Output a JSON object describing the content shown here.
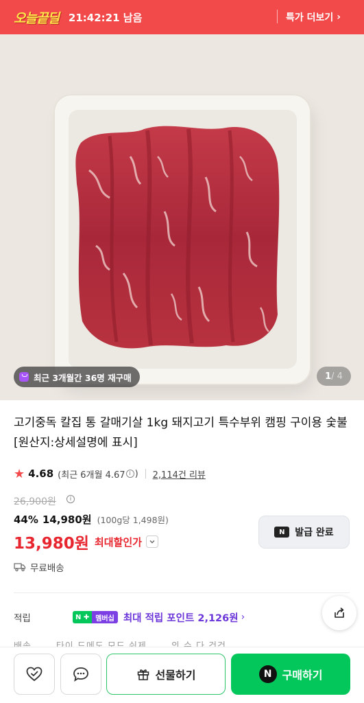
{
  "deal": {
    "logo": "오늘끝딜",
    "timer": "21:42:21 남음",
    "more_label": "특가 더보기",
    "more_chevron": "›"
  },
  "hero": {
    "repurchase_text": "최근 3개월간 36명 재구매",
    "counter_current": "1",
    "counter_total": "/ 4"
  },
  "product": {
    "title": "고기중독 칼집 통 갈매기살 1kg 돼지고기 특수부위 캠핑 구이용 숯불 [원산지:상세설명에 표시]",
    "rating": "4.68",
    "rating_recent_prefix": "(최근 6개월 4.67",
    "rating_recent_suffix": ")",
    "review_link": "2,114건 리뷰",
    "original_price": "26,900원",
    "discount_pct": "44%",
    "discount_price": "14,980원",
    "unit_price": "(100g당 1,498원)",
    "final_price": "13,980원",
    "final_label": "최대할인가",
    "coupon_label": "발급 완료",
    "shipping": "무료배송",
    "points_label": "적립",
    "points_text": "최대 적립 포인트 2,126원",
    "membership_badge": "멤버십",
    "partial_row_text": "배송 ..... 타이 드메도 모드 쉬제 ..... 의 수 다 건건 ..."
  },
  "bottom": {
    "gift_label": "선물하기",
    "buy_label": "구매하기",
    "npay_glyph": "N"
  },
  "colors": {
    "deal_red": "#f24a4a",
    "naver_green": "#03c75a",
    "price_red": "#e8262f",
    "points_purple": "#6b35d9"
  },
  "icons": [
    "star-icon",
    "info-icon",
    "truck-icon",
    "share-icon",
    "heart-icon",
    "chat-icon",
    "gift-icon",
    "npay-icon",
    "chevron-right-icon",
    "chevron-down-icon"
  ]
}
